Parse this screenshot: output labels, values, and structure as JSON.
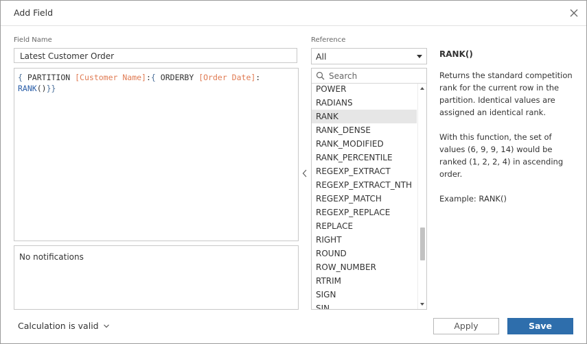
{
  "dialog": {
    "title": "Add Field"
  },
  "field_name": {
    "label": "Field Name",
    "value": "Latest Customer Order"
  },
  "editor": {
    "tokens": {
      "open_brace": "{",
      "partition": "PARTITION",
      "customer_name": "[Customer Name]",
      "colon1": ":",
      "open_brace2": "{",
      "orderby": "ORDERBY",
      "order_date": "[Order Date]",
      "colon2": ":",
      "rank_func": "RANK",
      "parens": "()",
      "close_braces": "}}"
    }
  },
  "notifications": {
    "text": "No notifications"
  },
  "status": {
    "label": "Calculation is valid"
  },
  "reference": {
    "label": "Reference",
    "selected": "All",
    "search_placeholder": "Search",
    "items": [
      "POWER",
      "RADIANS",
      "RANK",
      "RANK_DENSE",
      "RANK_MODIFIED",
      "RANK_PERCENTILE",
      "REGEXP_EXTRACT",
      "REGEXP_EXTRACT_NTH",
      "REGEXP_MATCH",
      "REGEXP_REPLACE",
      "REPLACE",
      "RIGHT",
      "ROUND",
      "ROW_NUMBER",
      "RTRIM",
      "SIGN",
      "SIN"
    ],
    "selected_item": "RANK"
  },
  "help": {
    "title": "RANK()",
    "paragraphs": [
      "Returns the standard competition rank for the current row in the partition. Identical values are assigned an identical rank.",
      "With this function, the set of values (6, 9, 9, 14) would be ranked (1, 2, 2, 4) in ascending order.",
      "Example: RANK()"
    ]
  },
  "buttons": {
    "apply": "Apply",
    "save": "Save"
  },
  "colors": {
    "primary": "#2e6eac",
    "field_token": "#e07b53",
    "function_token": "#2a5ea8",
    "selected_row": "#e6e6e6"
  }
}
